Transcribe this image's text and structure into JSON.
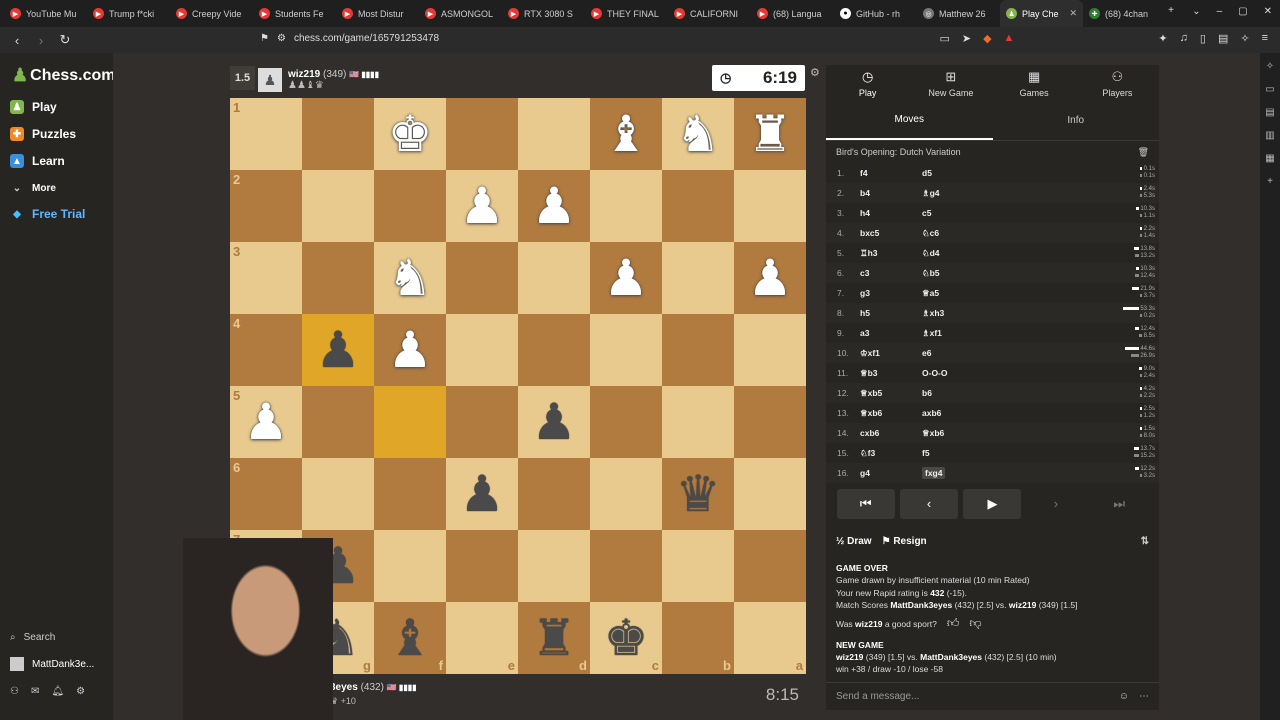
{
  "browser": {
    "tabs": [
      {
        "label": "YouTube Mu",
        "active": false
      },
      {
        "label": "Trump f*cki",
        "active": false
      },
      {
        "label": "Creepy Vide",
        "active": false
      },
      {
        "label": "Students Fe",
        "active": false
      },
      {
        "label": "Most Distur",
        "active": false
      },
      {
        "label": "ASMONGOL",
        "active": false
      },
      {
        "label": "RTX 3080 S",
        "active": false
      },
      {
        "label": "THEY FINAL",
        "active": false
      },
      {
        "label": "CALIFORNI",
        "active": false
      },
      {
        "label": "(68) Langua",
        "active": false
      },
      {
        "label": "GitHub - rh",
        "active": false
      },
      {
        "label": "Matthew 26",
        "active": false
      },
      {
        "label": "Play Che",
        "active": true
      },
      {
        "label": "(68) 4chan",
        "active": false
      }
    ],
    "url": "chess.com/game/165791253478"
  },
  "sidebar": {
    "logo": "Chess.com",
    "items": [
      {
        "label": "Play",
        "icon": "play-icon"
      },
      {
        "label": "Puzzles",
        "icon": "puzzle-icon"
      },
      {
        "label": "Learn",
        "icon": "learn-icon"
      },
      {
        "label": "More",
        "icon": "chevron-down-icon"
      },
      {
        "label": "Free Trial",
        "icon": "diamond-icon"
      }
    ],
    "search": "Search",
    "user": "MattDank3e..."
  },
  "game": {
    "top_player": {
      "score": "1.5",
      "name": "wiz219",
      "rating": "(349)",
      "captured": "♟♟♝♛"
    },
    "top_clock": "6:19",
    "bottom_player": {
      "name": "3eyes",
      "rating": "(432)",
      "advantage": "+10"
    },
    "bottom_clock": "8:15",
    "board": [
      [
        "",
        "",
        "♔",
        "",
        "",
        "♗",
        "♘",
        "♖"
      ],
      [
        "",
        "",
        "",
        "♙",
        "♙",
        "",
        "",
        ""
      ],
      [
        "",
        "",
        "♘",
        "",
        "",
        "♙",
        "",
        "♙"
      ],
      [
        "",
        "♟",
        "♙",
        "",
        "",
        "",
        "",
        ""
      ],
      [
        "♙",
        "",
        "",
        "",
        "♟",
        "",
        "",
        ""
      ],
      [
        "",
        "",
        "",
        "♟",
        "",
        "",
        "♛",
        ""
      ],
      [
        "",
        "♟",
        "",
        "",
        "",
        "",
        "",
        ""
      ],
      [
        "",
        "♞",
        "♝",
        "",
        "♜",
        "♚",
        "",
        ""
      ]
    ],
    "ranks": [
      "1",
      "2",
      "3",
      "4",
      "5",
      "6",
      "7",
      "8"
    ],
    "files": [
      "h",
      "g",
      "f",
      "e",
      "d",
      "c",
      "b",
      "a"
    ]
  },
  "panel": {
    "tabs": [
      {
        "label": "Play",
        "icon": "stopwatch-icon"
      },
      {
        "label": "New Game",
        "icon": "plus-icon"
      },
      {
        "label": "Games",
        "icon": "grid-icon"
      },
      {
        "label": "Players",
        "icon": "players-icon"
      }
    ],
    "subtabs": [
      "Moves",
      "Info"
    ],
    "opening": "Bird's Opening: Dutch Variation",
    "moves": [
      {
        "n": "1.",
        "w": "f4",
        "b": "d5",
        "tw": "0.1s",
        "tb": "0.1s",
        "fw": 0.01,
        "fb": 0.01
      },
      {
        "n": "2.",
        "w": "b4",
        "b": "♗g4",
        "tw": "2.4s",
        "tb": "5.3s",
        "fw": 0.05,
        "fb": 0.1
      },
      {
        "n": "3.",
        "w": "h4",
        "b": "c5",
        "tw": "10.3s",
        "tb": "1.1s",
        "fw": 0.19,
        "fb": 0.02
      },
      {
        "n": "4.",
        "w": "bxc5",
        "b": "♘c6",
        "tw": "2.2s",
        "tb": "1.4s",
        "fw": 0.04,
        "fb": 0.03
      },
      {
        "n": "5.",
        "w": "♖h3",
        "b": "♘d4",
        "tw": "13.8s",
        "tb": "13.2s",
        "fw": 0.26,
        "fb": 0.25
      },
      {
        "n": "6.",
        "w": "c3",
        "b": "♘b5",
        "tw": "10.3s",
        "tb": "12.4s",
        "fw": 0.19,
        "fb": 0.23
      },
      {
        "n": "7.",
        "w": "g3",
        "b": "♕a5",
        "tw": "21.9s",
        "tb": "3.7s",
        "fw": 0.41,
        "fb": 0.07
      },
      {
        "n": "8.",
        "w": "h5",
        "b": "♗xh3",
        "tw": "53.3s",
        "tb": "0.2s",
        "fw": 1.0,
        "fb": 0.01
      },
      {
        "n": "9.",
        "w": "a3",
        "b": "♗xf1",
        "tw": "12.4s",
        "tb": "8.5s",
        "fw": 0.23,
        "fb": 0.16
      },
      {
        "n": "10.",
        "w": "♔xf1",
        "b": "e6",
        "tw": "44.6s",
        "tb": "26.9s",
        "fw": 0.84,
        "fb": 0.5
      },
      {
        "n": "11.",
        "w": "♕b3",
        "b": "O-O-O",
        "tw": "9.0s",
        "tb": "2.4s",
        "fw": 0.17,
        "fb": 0.05
      },
      {
        "n": "12.",
        "w": "♕xb5",
        "b": "b6",
        "tw": "4.2s",
        "tb": "2.2s",
        "fw": 0.08,
        "fb": 0.04
      },
      {
        "n": "13.",
        "w": "♕xb6",
        "b": "axb6",
        "tw": "2.5s",
        "tb": "1.2s",
        "fw": 0.05,
        "fb": 0.02
      },
      {
        "n": "14.",
        "w": "cxb6",
        "b": "♕xb6",
        "tw": "1.5s",
        "tb": "8.0s",
        "fw": 0.03,
        "fb": 0.15
      },
      {
        "n": "15.",
        "w": "♘f3",
        "b": "f5",
        "tw": "13.7s",
        "tb": "15.2s",
        "fw": 0.26,
        "fb": 0.29
      },
      {
        "n": "16.",
        "w": "g4",
        "b": "fxg4",
        "tw": "12.2s",
        "tb": "3.2s",
        "fw": 0.23,
        "fb": 0.06
      }
    ],
    "draw_label": "Draw",
    "resign_label": "Resign",
    "result": {
      "title": "GAME OVER",
      "line1": "Game drawn by insufficient material (10 min Rated)",
      "line2_prefix": "Your new Rapid rating is ",
      "line2_value": "432",
      "line2_suffix": " (-15).",
      "line3_prefix": "Match Scores ",
      "line3_p1": "MattDank3eyes",
      "line3_mid": " (432) [2.5] vs. ",
      "line3_p2": "wiz219",
      "line3_end": " (349) [1.5]",
      "sport_q_prefix": "Was ",
      "sport_q_name": "wiz219",
      "sport_q_suffix": " a good sport?",
      "new_game": "NEW GAME",
      "ng_p1": "wiz219",
      "ng_mid": " (349) [1.5] vs. ",
      "ng_p2": "MattDank3eyes",
      "ng_end": " (432) [2.5] (10 min)",
      "ng_stakes": "win +38 / draw -10 / lose -58"
    },
    "message_placeholder": "Send a message..."
  }
}
